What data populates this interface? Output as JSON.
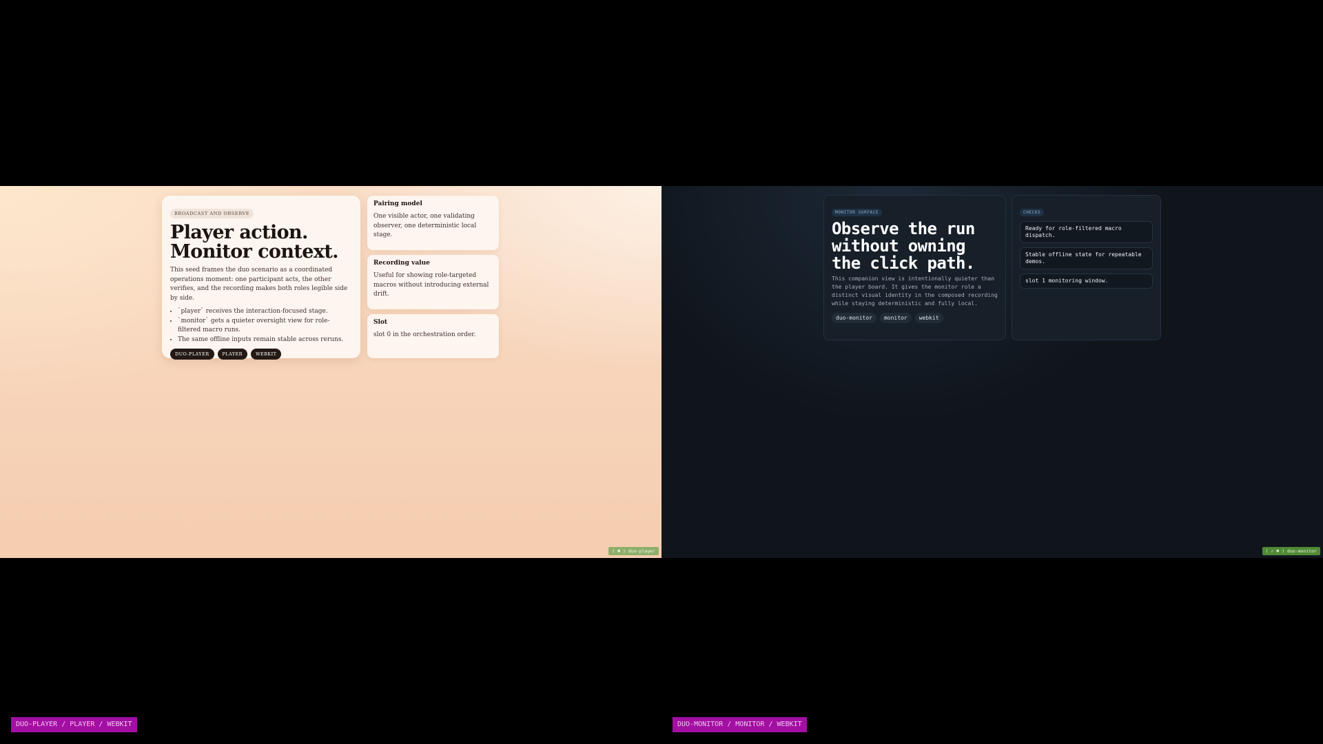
{
  "player": {
    "eyebrow": "BROADCAST AND OBSERVE",
    "title_line1": "Player action.",
    "title_line2": "Monitor context.",
    "description": "This seed frames the duo scenario as a coordinated operations moment: one participant acts, the other verifies, and the recording makes both roles legible side by side.",
    "bullets": [
      "`player` receives the interaction-focused stage.",
      "`monitor` gets a quieter oversight view for role-filtered macro runs.",
      "The same offline inputs remain stable across reruns."
    ],
    "chips": [
      "DUO-PLAYER",
      "PLAYER",
      "WEBKIT"
    ],
    "cards": [
      {
        "title": "Pairing model",
        "text": "One visible actor, one validating observer, one deterministic local stage."
      },
      {
        "title": "Recording value",
        "text": "Useful for showing role-targeted macros without introducing external drift."
      },
      {
        "title": "Slot",
        "text": "slot 0 in the orchestration order."
      }
    ],
    "stamp": "( ☻ ) duo-player"
  },
  "monitor": {
    "tag": "MONITOR SURFACE",
    "title": "Observe the run without owning the click path.",
    "description": "This companion view is intentionally quieter than the player board. It gives the monitor role a distinct visual identity in the composed recording while staying deterministic and fully local.",
    "chips": [
      "duo-monitor",
      "monitor",
      "webkit"
    ],
    "checks_tag": "CHECKS",
    "checks": [
      "Ready for role-filtered macro dispatch.",
      "Stable offline state for repeatable demos.",
      "slot 1 monitoring window."
    ],
    "stamp": "( ✓ ☻ ) duo-monitor"
  },
  "footer": {
    "left": "DUO-PLAYER / PLAYER / WEBKIT",
    "right": "DUO-MONITOR / MONITOR / WEBKIT"
  },
  "colors": {
    "footer_bg": "#a30fa3",
    "monitor_bg": "#10151c",
    "player_bg": "#f5cdb0"
  }
}
